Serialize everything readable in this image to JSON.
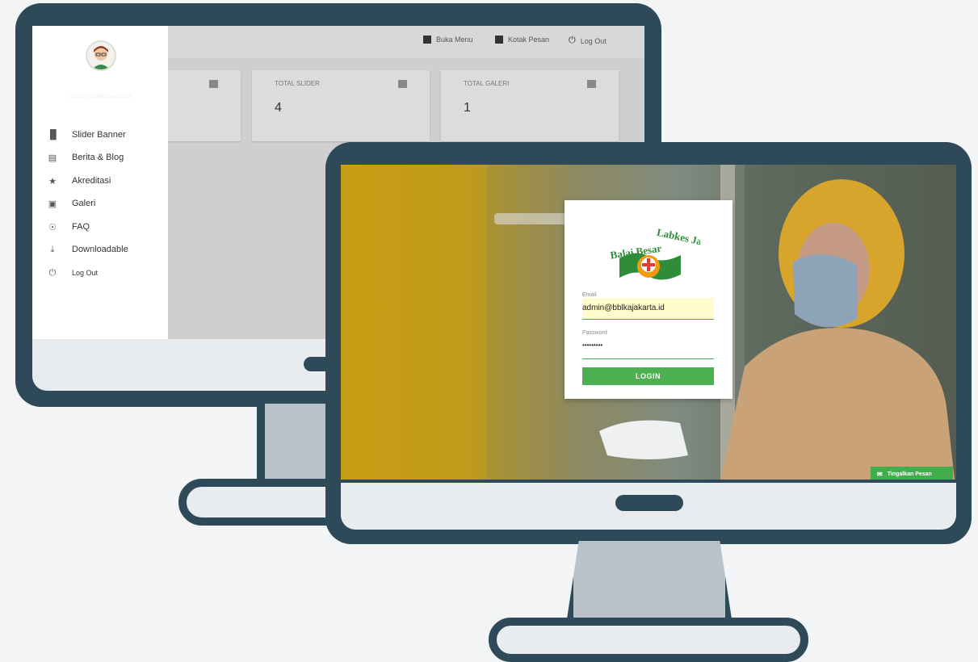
{
  "dashboard": {
    "topbar": {
      "buka_menu": "Buka Menu",
      "kotak_pesan": "Kotak Pesan",
      "log_out": "Log Out"
    },
    "cards": [
      {
        "title": "",
        "value": "",
        "icon": "newspaper-icon"
      },
      {
        "title": "TOTAL SLIDER",
        "value": "4",
        "icon": "slider-icon"
      },
      {
        "title": "TOTAL GALERI",
        "value": "1",
        "icon": "image-icon"
      }
    ],
    "sidebar": {
      "user_name": "Admin",
      "user_email": "admin@bblkjakarta.id",
      "items": [
        {
          "label": "Slider Banner",
          "icon": "slider-icon"
        },
        {
          "label": "Berita & Blog",
          "icon": "newspaper-icon"
        },
        {
          "label": "Akreditasi",
          "icon": "star-icon"
        },
        {
          "label": "Galeri",
          "icon": "image-icon"
        },
        {
          "label": "FAQ",
          "icon": "lightbulb-icon"
        },
        {
          "label": "Downloadable",
          "icon": "download-icon"
        },
        {
          "label": "Log Out",
          "icon": "power-icon"
        }
      ]
    }
  },
  "login": {
    "logo_text": "Balai Besar Labkes Jakarta",
    "email_label": "Email",
    "email_value": "admin@bblkajakarta.id",
    "password_label": "Password",
    "password_value": "•••••••••",
    "login_button": "LOGIN",
    "leave_message": "Tingalkan Pesan"
  },
  "colors": {
    "frame": "#2e4a58",
    "accent_green": "#4caf50",
    "stand": "#b9c2c8"
  }
}
